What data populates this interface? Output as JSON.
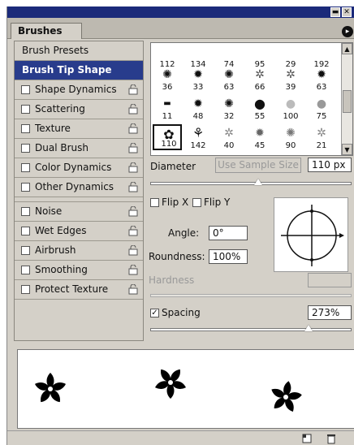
{
  "tab": {
    "label": "Brushes"
  },
  "left_list": [
    {
      "label": "Brush Presets",
      "type": "plain"
    },
    {
      "label": "Brush Tip Shape",
      "type": "active"
    },
    {
      "label": "Shape Dynamics",
      "type": "check"
    },
    {
      "label": "Scattering",
      "type": "check"
    },
    {
      "label": "Texture",
      "type": "check"
    },
    {
      "label": "Dual Brush",
      "type": "check"
    },
    {
      "label": "Color Dynamics",
      "type": "check"
    },
    {
      "label": "Other Dynamics",
      "type": "check"
    },
    {
      "label": "Noise",
      "type": "check"
    },
    {
      "label": "Wet Edges",
      "type": "check"
    },
    {
      "label": "Airbrush",
      "type": "check"
    },
    {
      "label": "Smoothing",
      "type": "check"
    },
    {
      "label": "Protect Texture",
      "type": "check"
    }
  ],
  "brush_grid": {
    "rows": [
      [
        "112",
        "134",
        "74",
        "95",
        "29",
        "192"
      ],
      [
        "36",
        "33",
        "63",
        "66",
        "39",
        "63"
      ],
      [
        "11",
        "48",
        "32",
        "55",
        "100",
        "75"
      ],
      [
        "110",
        "142",
        "40",
        "45",
        "90",
        "21"
      ]
    ],
    "selected": "110"
  },
  "diameter": {
    "label": "Diameter",
    "button": "Use Sample Size",
    "value": "110 px"
  },
  "flip": {
    "x": "Flip X",
    "y": "Flip Y"
  },
  "angle": {
    "label": "Angle:",
    "value": "0°"
  },
  "roundness": {
    "label": "Roundness:",
    "value": "100%"
  },
  "hardness": {
    "label": "Hardness"
  },
  "spacing": {
    "label": "Spacing",
    "value": "273%",
    "checked": true
  },
  "icons": {
    "new": "new-brush-icon",
    "delete": "trash-icon",
    "menu": "panel-menu-icon"
  }
}
